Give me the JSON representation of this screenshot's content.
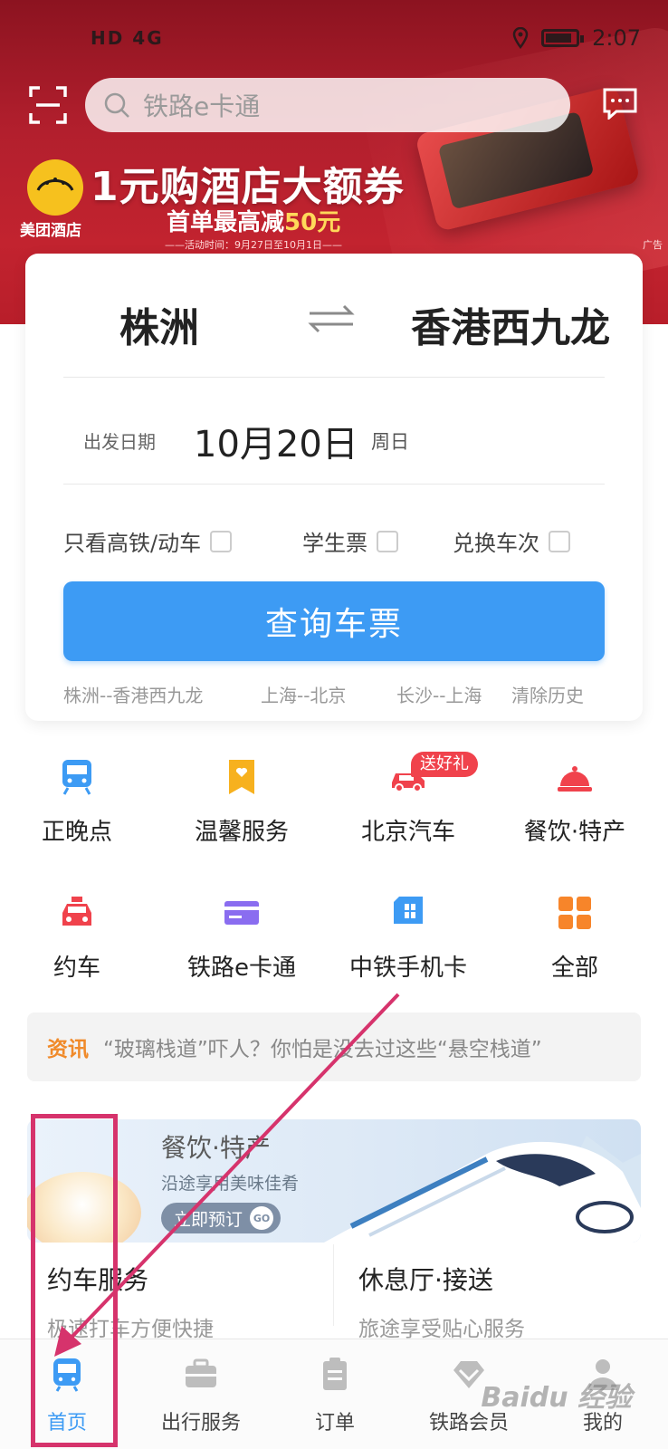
{
  "status_bar": {
    "left": "HD 4G",
    "time": "2:07"
  },
  "header": {
    "search_placeholder": "铁路e卡通"
  },
  "banner": {
    "brand": "美团酒店",
    "title": "1元购酒店大额券",
    "subtitle_pre": "首单最高减",
    "subtitle_amount": "50元",
    "date_note": "——活动时间：9月27日至10月1日——",
    "ad_tag": "广告"
  },
  "ticket": {
    "from": "株洲",
    "to": "香港西九龙",
    "date_label": "出发日期",
    "date": "10月20日",
    "weekday": "周日",
    "options": [
      "只看高铁/动车",
      "学生票",
      "兑换车次"
    ],
    "query_button": "查询车票",
    "history": [
      "株洲--香港西九龙",
      "上海--北京",
      "长沙--上海"
    ],
    "clear_history": "清除历史"
  },
  "services": [
    {
      "label": "正晚点",
      "icon": "train-icon",
      "color": "#3d9bf4"
    },
    {
      "label": "温馨服务",
      "icon": "bookmark-heart-icon",
      "color": "#f7b11e"
    },
    {
      "label": "北京汽车",
      "icon": "car-icon",
      "color": "#f0424c",
      "badge": "送好礼"
    },
    {
      "label": "餐饮·特产",
      "icon": "food-cover-icon",
      "color": "#f0424c"
    },
    {
      "label": "约车",
      "icon": "taxi-icon",
      "color": "#f0424c"
    },
    {
      "label": "铁路e卡通",
      "icon": "card-icon",
      "color": "#8a6df0"
    },
    {
      "label": "中铁手机卡",
      "icon": "sim-card-icon",
      "color": "#3d9bf4"
    },
    {
      "label": "全部",
      "icon": "grid-icon",
      "color": "#f7852a"
    }
  ],
  "news": {
    "tag": "资讯",
    "text": "“玻璃栈道”吓人？你怕是没去过这些“悬空栈道”"
  },
  "food_banner": {
    "title": "餐饮·特产",
    "subtitle": "沿途享用美味佳肴",
    "button": "立即预订",
    "go": "GO"
  },
  "mini_cards": [
    {
      "title": "约车服务",
      "subtitle": "极速打车方便快捷"
    },
    {
      "title": "休息厅·接送",
      "subtitle": "旅途享受贴心服务"
    }
  ],
  "tabs": [
    {
      "label": "首页",
      "icon": "home-train-icon",
      "active": true
    },
    {
      "label": "出行服务",
      "icon": "briefcase-icon",
      "active": false
    },
    {
      "label": "订单",
      "icon": "clipboard-icon",
      "active": false
    },
    {
      "label": "铁路会员",
      "icon": "diamond-icon",
      "active": false
    },
    {
      "label": "我的",
      "icon": "person-icon",
      "active": false
    }
  ],
  "colors": {
    "accent": "#3d9bf4",
    "banner": "#b21f2d",
    "annotation": "#d6336c",
    "news_tag": "#f08a2a"
  },
  "watermark": "Baidu 经验"
}
